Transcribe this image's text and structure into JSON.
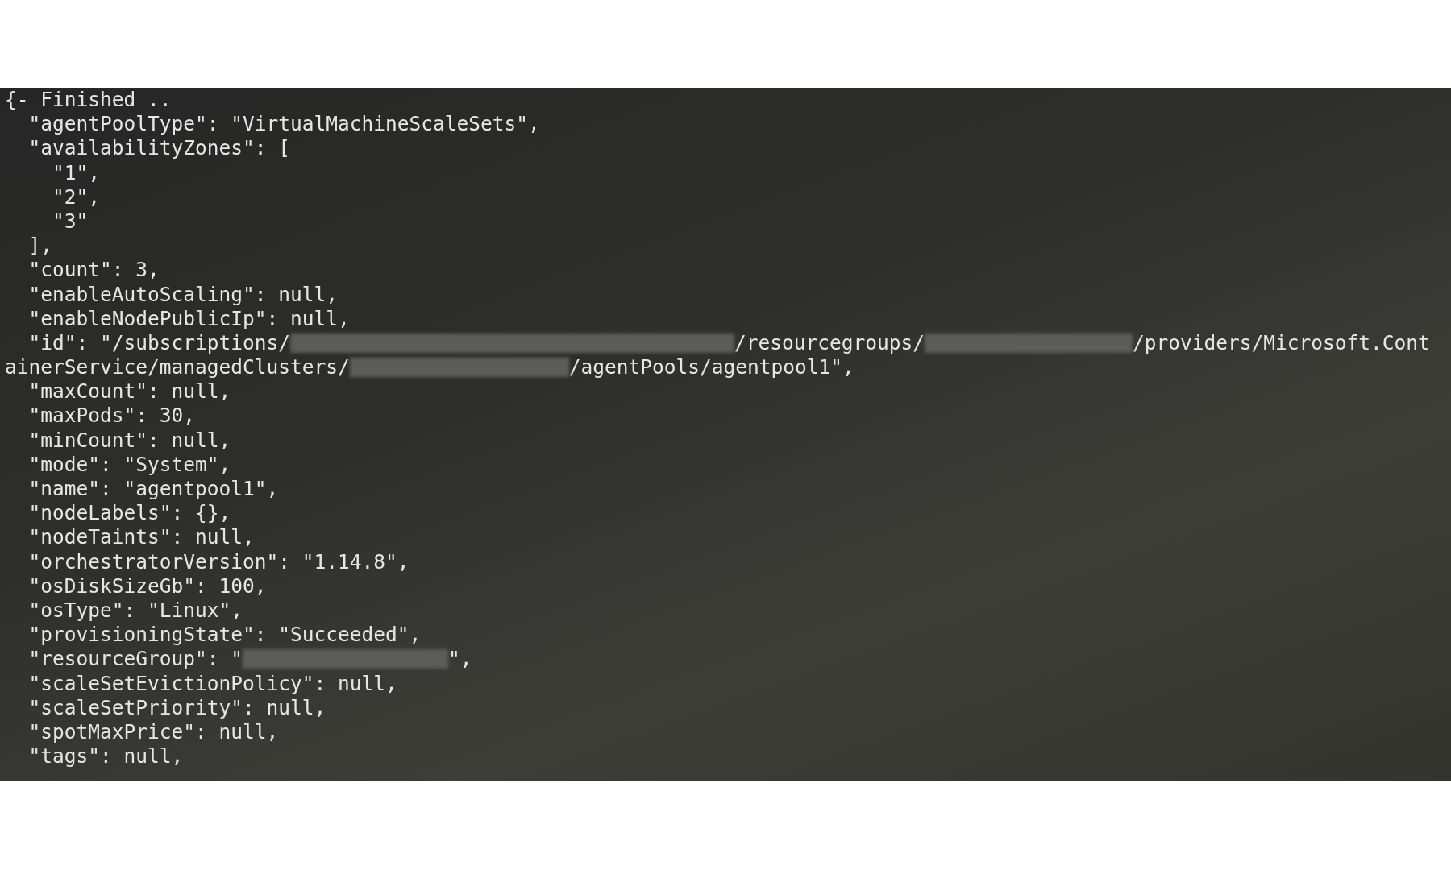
{
  "terminal": {
    "lines": [
      {
        "text": "{- Finished .."
      },
      {
        "text": "  \"agentPoolType\": \"VirtualMachineScaleSets\","
      },
      {
        "text": "  \"availabilityZones\": ["
      },
      {
        "text": "    \"1\","
      },
      {
        "text": "    \"2\","
      },
      {
        "text": "    \"3\""
      },
      {
        "text": "  ],"
      },
      {
        "text": "  \"count\": 3,"
      },
      {
        "text": "  \"enableAutoScaling\": null,"
      },
      {
        "text": "  \"enableNodePublicIp\": null,"
      },
      {
        "parts": [
          {
            "kind": "text",
            "text": "  \"id\": \"/subscriptions/"
          },
          {
            "kind": "redacted"
          },
          {
            "kind": "text",
            "text": "/resourcegroups/"
          },
          {
            "kind": "redacted"
          },
          {
            "kind": "text",
            "text": "/providers/Microsoft.Cont"
          }
        ]
      },
      {
        "parts": [
          {
            "kind": "text",
            "text": "ainerService/managedClusters/"
          },
          {
            "kind": "redacted"
          },
          {
            "kind": "text",
            "text": "/agentPools/agentpool1\","
          }
        ]
      },
      {
        "text": "  \"maxCount\": null,"
      },
      {
        "text": "  \"maxPods\": 30,"
      },
      {
        "text": "  \"minCount\": null,"
      },
      {
        "text": "  \"mode\": \"System\","
      },
      {
        "text": "  \"name\": \"agentpool1\","
      },
      {
        "text": "  \"nodeLabels\": {},"
      },
      {
        "text": "  \"nodeTaints\": null,"
      },
      {
        "text": "  \"orchestratorVersion\": \"1.14.8\","
      },
      {
        "text": "  \"osDiskSizeGb\": 100,"
      },
      {
        "text": "  \"osType\": \"Linux\","
      },
      {
        "text": "  \"provisioningState\": \"Succeeded\","
      },
      {
        "parts": [
          {
            "kind": "text",
            "text": "  \"resourceGroup\": \""
          },
          {
            "kind": "redacted"
          },
          {
            "kind": "text",
            "text": "\","
          }
        ]
      },
      {
        "text": "  \"scaleSetEvictionPolicy\": null,"
      },
      {
        "text": "  \"scaleSetPriority\": null,"
      },
      {
        "text": "  \"spotMaxPrice\": null,"
      },
      {
        "text": "  \"tags\": null,"
      }
    ]
  }
}
